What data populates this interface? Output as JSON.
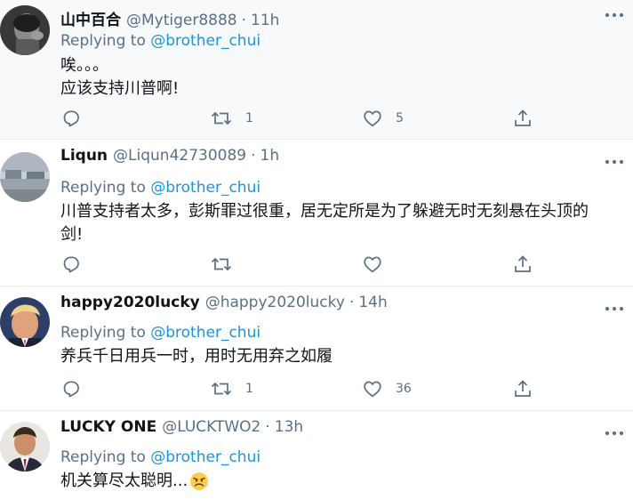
{
  "tweets": [
    {
      "name": "山中百合",
      "handle": "@Mytiger8888",
      "dot": "·",
      "time": "11h",
      "replying_prefix": "Replying to ",
      "replying_to": "@brother_chui",
      "lines": [
        "唉。。。",
        "应该支持川普啊!"
      ],
      "retweets": "1",
      "likes": "5",
      "avatar": "dark-portrait-avatar"
    },
    {
      "name": "Liqun",
      "handle": "@Liqun42730089",
      "dot": "·",
      "time": "1h",
      "replying_prefix": "Replying to ",
      "replying_to": "@brother_chui",
      "lines": [
        "川普支持者太多，彭斯罪过很重，居无定所是为了躲避无时无刻悬在头顶的",
        "剑!"
      ],
      "retweets": "",
      "likes": "",
      "avatar": "landscape-avatar"
    },
    {
      "name": "happy2020lucky",
      "handle": "@happy2020lucky",
      "dot": "·",
      "time": "14h",
      "replying_prefix": "Replying to ",
      "replying_to": "@brother_chui",
      "lines": [
        "养兵千日用兵一时，用时无用弃之如履"
      ],
      "retweets": "1",
      "likes": "36",
      "avatar": "man-portrait-avatar"
    },
    {
      "name": "LUCKY ONE",
      "handle": "@LUCKTWO2",
      "dot": "·",
      "time": "13h",
      "replying_prefix": "Replying to ",
      "replying_to": "@brother_chui",
      "lines": [
        "机关算尽太聪明..."
      ],
      "emoji": "angry-face-emoji",
      "avatar": "man-suit-avatar"
    }
  ],
  "icons": [
    "reply-icon",
    "retweet-icon",
    "like-icon",
    "share-icon",
    "more-icon"
  ],
  "colors": {
    "link": "#1b95e0",
    "muted": "#5b7083",
    "text": "#0f1419",
    "highlight_bg": "#f7f9fa",
    "divider": "#e6ecf0"
  }
}
